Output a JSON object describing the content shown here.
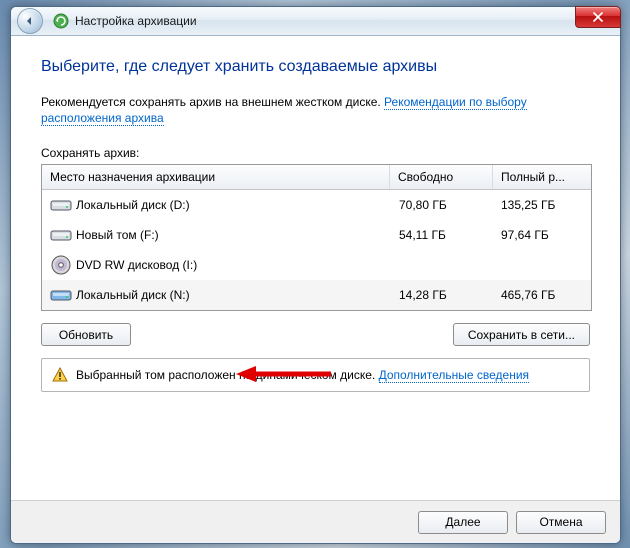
{
  "titlebar": {
    "title": "Настройка архивации"
  },
  "content": {
    "heading": "Выберите, где следует хранить создаваемые архивы",
    "recommend_text": "Рекомендуется сохранять архив на внешнем жестком диске. ",
    "recommend_link": "Рекомендации по выбору расположения архива",
    "section_label": "Сохранять архив:",
    "columns": {
      "name": "Место назначения архивации",
      "free": "Свободно",
      "total": "Полный р..."
    },
    "drives": [
      {
        "name": "Локальный диск (D:)",
        "free": "70,80 ГБ",
        "total": "135,25 ГБ",
        "type": "hdd"
      },
      {
        "name": "Новый том (F:)",
        "free": "54,11 ГБ",
        "total": "97,64 ГБ",
        "type": "hdd"
      },
      {
        "name": "DVD RW дисковод (I:)",
        "free": "",
        "total": "",
        "type": "dvd"
      },
      {
        "name": "Локальный диск (N:)",
        "free": "14,28 ГБ",
        "total": "465,76 ГБ",
        "type": "hdd",
        "selected": true
      }
    ],
    "refresh_btn": "Обновить",
    "network_btn": "Сохранить в сети...",
    "warning_text": "Выбранный том расположен на динамическом диске. ",
    "warning_link": "Дополнительные сведения"
  },
  "footer": {
    "next": "Далее",
    "cancel": "Отмена"
  }
}
